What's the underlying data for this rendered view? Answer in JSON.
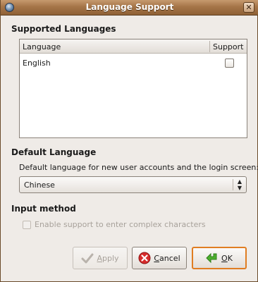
{
  "window": {
    "title": "Language Support"
  },
  "supported": {
    "section_title": "Supported Languages",
    "columns": {
      "language": "Language",
      "support": "Support"
    },
    "rows": [
      {
        "language": "English",
        "supported": false
      }
    ]
  },
  "default_language": {
    "section_title": "Default Language",
    "description": "Default language for new user accounts and the login screen:",
    "selected": "Chinese"
  },
  "input_method": {
    "section_title": "Input method",
    "checkbox_label": "Enable support to enter complex characters",
    "enabled": false
  },
  "buttons": {
    "apply": {
      "mnemonic": "A",
      "rest": "pply",
      "enabled": false
    },
    "cancel": {
      "mnemonic": "C",
      "rest": "ancel"
    },
    "ok": {
      "mnemonic": "O",
      "rest": "K"
    }
  },
  "colors": {
    "ok_focus": "#e07d22",
    "titlebar": "#a57548"
  },
  "icons": {
    "window_menu": "window-menu-icon",
    "close": "close-icon",
    "apply": "checkmark-icon",
    "cancel": "cancel-icon",
    "ok": "ok-arrow-icon",
    "combo": "combo-arrows-icon"
  }
}
